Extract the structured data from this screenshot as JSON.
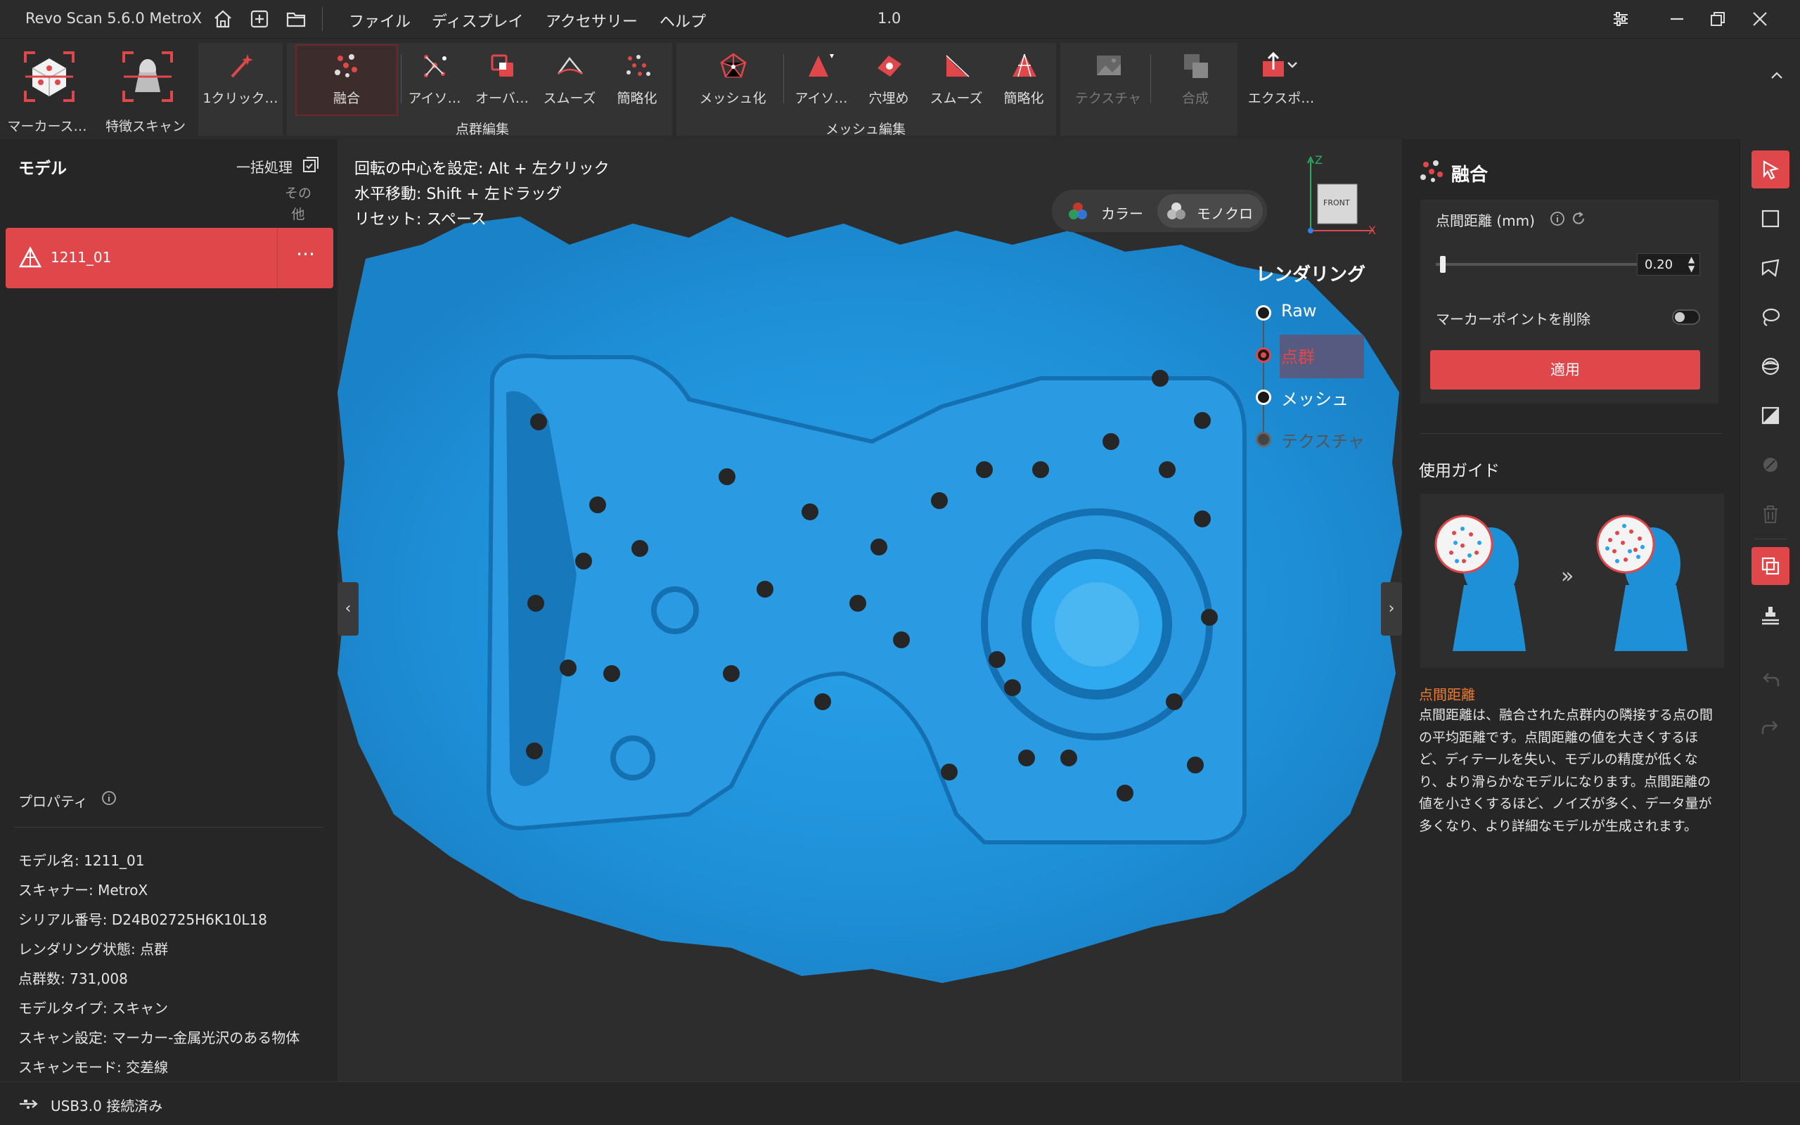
{
  "titlebar": {
    "app_title": "Revo Scan 5.6.0 MetroX",
    "menus": [
      "ファイル",
      "ディスプレイ",
      "アクセサリー",
      "ヘルプ"
    ],
    "version": "1.0"
  },
  "toolbar": {
    "marker_scan": "マーカース…",
    "feature_scan": "特徴スキャン",
    "one_click": "1クリック…",
    "pc_tools": [
      "融合",
      "アイソ…",
      "オーバ…",
      "スムーズ",
      "簡略化"
    ],
    "pc_group": "点群編集",
    "mesh_tools": [
      "メッシュ化",
      "アイソ…",
      "穴埋め",
      "スムーズ",
      "簡略化"
    ],
    "mesh_group": "メッシュ編集",
    "texture": "テクスチャ",
    "merge": "合成",
    "export": "エクスポ…",
    "accent": "#e0474a"
  },
  "left": {
    "title": "モデル",
    "batch": "一括処理",
    "other": "その他",
    "model_name": "1211_01",
    "more": "···",
    "props_title": "プロパティ",
    "props": [
      "モデル名:  1211_01",
      "スキャナー:  MetroX",
      "シリアル番号:  D24B02725H6K10L18",
      "レンダリング状態:  点群",
      "点群数:  731,008",
      "モデルタイプ:  スキャン",
      "スキャン設定:  マーカー-金属光沢のある物体",
      "スキャンモード:  交差線"
    ]
  },
  "viewport": {
    "hints": [
      "回転の中心を設定: Alt + 左クリック",
      "水平移動: Shift + 左ドラッグ",
      "リセット: スペース"
    ],
    "color": "カラー",
    "mono": "モノクロ",
    "cube_label": "FRONT",
    "axis_z": "Z",
    "axis_x": "X",
    "render_title": "レンダリング",
    "render_options": [
      "Raw",
      "点群",
      "メッシュ",
      "テクスチャ"
    ],
    "model_color": "#1e90d8"
  },
  "right": {
    "title": "融合",
    "spacing_label": "点間距離 (mm)",
    "spacing_value": "0.20",
    "spacing_slider_fraction": 0.02,
    "marker_remove": "マーカーポイントを削除",
    "marker_remove_on": false,
    "apply": "適用",
    "guide_title": "使用ガイド",
    "guide_subtitle": "点間距離",
    "guide_text": "点間距離は、融合された点群内の隣接する点の間の平均距離です。点間距離の値を大きくするほど、ディテールを失い、モデルの精度が低くなり、より滑らかなモデルになります。点間距離の値を小さくするほど、ノイズが多く、データ量が多くなり、より詳細なモデルが生成されます。",
    "guide_arrow": "»"
  },
  "status": {
    "usb": "USB3.0 接続済み"
  }
}
